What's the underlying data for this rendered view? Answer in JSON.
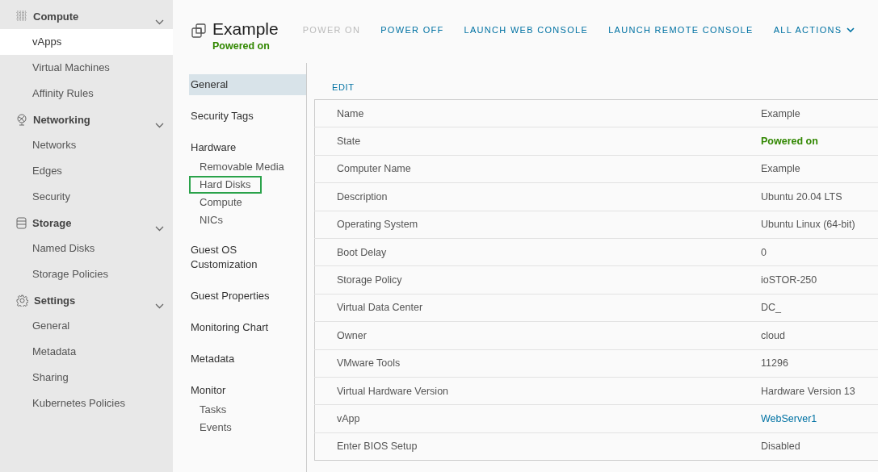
{
  "sidebar": {
    "sections": [
      {
        "title": "Compute",
        "expanded": true,
        "items": [
          {
            "label": "vApps",
            "selected": true
          },
          {
            "label": "Virtual Machines",
            "selected": false
          },
          {
            "label": "Affinity Rules",
            "selected": false
          }
        ]
      },
      {
        "title": "Networking",
        "expanded": true,
        "items": [
          {
            "label": "Networks",
            "selected": false
          },
          {
            "label": "Edges",
            "selected": false
          },
          {
            "label": "Security",
            "selected": false
          }
        ]
      },
      {
        "title": "Storage",
        "expanded": true,
        "items": [
          {
            "label": "Named Disks",
            "selected": false
          },
          {
            "label": "Storage Policies",
            "selected": false
          }
        ]
      },
      {
        "title": "Settings",
        "expanded": true,
        "items": [
          {
            "label": "General",
            "selected": false
          },
          {
            "label": "Metadata",
            "selected": false
          },
          {
            "label": "Sharing",
            "selected": false
          },
          {
            "label": "Kubernetes Policies",
            "selected": false
          }
        ]
      }
    ]
  },
  "header": {
    "title": "Example",
    "status": "Powered on",
    "actions": [
      {
        "label": "POWER ON",
        "disabled": true,
        "dropdown": false
      },
      {
        "label": "POWER OFF",
        "disabled": false,
        "dropdown": false
      },
      {
        "label": "LAUNCH WEB CONSOLE",
        "disabled": false,
        "dropdown": false
      },
      {
        "label": "LAUNCH REMOTE CONSOLE",
        "disabled": false,
        "dropdown": false
      },
      {
        "label": "ALL ACTIONS",
        "disabled": false,
        "dropdown": true
      }
    ]
  },
  "subnav": {
    "items": [
      {
        "label": "General",
        "selected": true,
        "highlighted": false
      },
      {
        "label": "Security Tags",
        "selected": false,
        "highlighted": false
      },
      {
        "label": "Hardware",
        "selected": false,
        "highlighted": false,
        "children": [
          {
            "label": "Removable Media",
            "selected": false,
            "highlighted": false
          },
          {
            "label": "Hard Disks",
            "selected": false,
            "highlighted": true
          },
          {
            "label": "Compute",
            "selected": false,
            "highlighted": false
          },
          {
            "label": "NICs",
            "selected": false,
            "highlighted": false
          }
        ]
      },
      {
        "label": "Guest OS Customization",
        "selected": false,
        "highlighted": false
      },
      {
        "label": "Guest Properties",
        "selected": false,
        "highlighted": false
      },
      {
        "label": "Monitoring Chart",
        "selected": false,
        "highlighted": false
      },
      {
        "label": "Metadata",
        "selected": false,
        "highlighted": false
      },
      {
        "label": "Monitor",
        "selected": false,
        "highlighted": false,
        "children": [
          {
            "label": "Tasks",
            "selected": false,
            "highlighted": false
          },
          {
            "label": "Events",
            "selected": false,
            "highlighted": false
          }
        ]
      }
    ]
  },
  "edit_button": "EDIT",
  "properties": {
    "rows": [
      {
        "name": "Name",
        "value": "Example",
        "kind": "text"
      },
      {
        "name": "State",
        "value": "Powered on",
        "kind": "status"
      },
      {
        "name": "Computer Name",
        "value": "Example",
        "kind": "text"
      },
      {
        "name": "Description",
        "value": "Ubuntu 20.04 LTS",
        "kind": "text"
      },
      {
        "name": "Operating System",
        "value": "Ubuntu Linux (64-bit)",
        "kind": "text"
      },
      {
        "name": "Boot Delay",
        "value": "0",
        "kind": "text"
      },
      {
        "name": "Storage Policy",
        "value": "ioSTOR-250",
        "kind": "text"
      },
      {
        "name": "Virtual Data Center",
        "value": "DC_",
        "kind": "text"
      },
      {
        "name": "Owner",
        "value": "cloud",
        "kind": "text"
      },
      {
        "name": "VMware Tools",
        "value": "11296",
        "kind": "text"
      },
      {
        "name": "Virtual Hardware Version",
        "value": "Hardware Version 13",
        "kind": "text"
      },
      {
        "name": "vApp",
        "value": "WebServer1",
        "kind": "link"
      },
      {
        "name": "Enter BIOS Setup",
        "value": "Disabled",
        "kind": "text"
      }
    ]
  }
}
